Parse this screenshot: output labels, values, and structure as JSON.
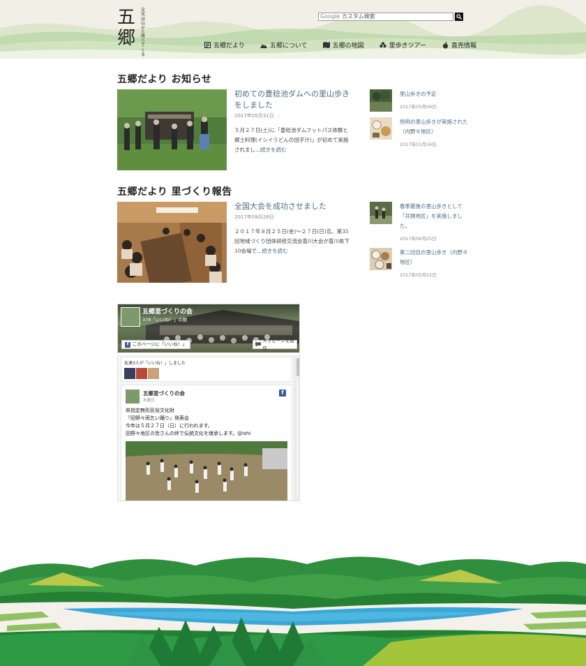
{
  "header": {
    "logo_text": "五郷",
    "logo_tagline": "文化は山から降りてくる",
    "search": {
      "brand": "Google",
      "placeholder": "カスタム検索"
    },
    "nav": [
      {
        "label": "五郷だより",
        "icon": "newspaper-icon"
      },
      {
        "label": "五郷について",
        "icon": "mountain-icon"
      },
      {
        "label": "五郷の地図",
        "icon": "map-icon"
      },
      {
        "label": "里歩きツアー",
        "icon": "flower-icon"
      },
      {
        "label": "直売情報",
        "icon": "vegetable-icon"
      }
    ]
  },
  "news": {
    "title": "五郷だより お知らせ",
    "post": {
      "title": "初めての豊稔池ダムへの里山歩きをしました",
      "date": "2017年05月31日",
      "excerpt": "５月２７日(土)に「豊稔池ダムフットパス体験と郷土料理(イシイうどんの団子汁)」が初めて実施されまし...",
      "more": "続きを読む"
    },
    "side": [
      {
        "title": "里山歩きの予定",
        "date": "2017年05月06日"
      },
      {
        "title": "恒例の里山歩きが実施された（内野々地区）",
        "date": "2017年01月16日"
      }
    ]
  },
  "report": {
    "title": "五郷だより 里づくり報告",
    "post": {
      "title": "全国大会を成功させました",
      "date": "2017年09月28日",
      "excerpt": "２０１７年８月２５日(金)～２７日(日)迄、第35回地域づくり団体研修交流会香川大会が香川県下10会場で...",
      "more": "続きを読む"
    },
    "side": [
      {
        "title": "春季最後の里山歩きとして「井関地区」を実施しました。",
        "date": "2017年06月25日"
      },
      {
        "title": "第二回目の里山歩き（内野々地区）",
        "date": "2017年05月22日"
      }
    ]
  },
  "facebook": {
    "page_name": "五郷里づくりの会",
    "likes": "378「いいね！」の数",
    "like_button": "このページに「いいね！」",
    "message_button": "メッセージを送信",
    "friends_text": "友達3人が「いいね！」しました",
    "post": {
      "author": "五郷里づくりの会",
      "date": "木曜日",
      "lines": [
        "県指定無形民俗文化財",
        "『田野々雨乞い踊り』発表会",
        "今年は５月２７日（日）に行われます。",
        "田野々地区の皆さんの絆で伝統文化を継承します。@ishi"
      ]
    }
  },
  "colors": {
    "link": "#4b6b85",
    "facebook": "#3b5998",
    "forest": "#2e8b3a",
    "river": "#39a8d8"
  }
}
